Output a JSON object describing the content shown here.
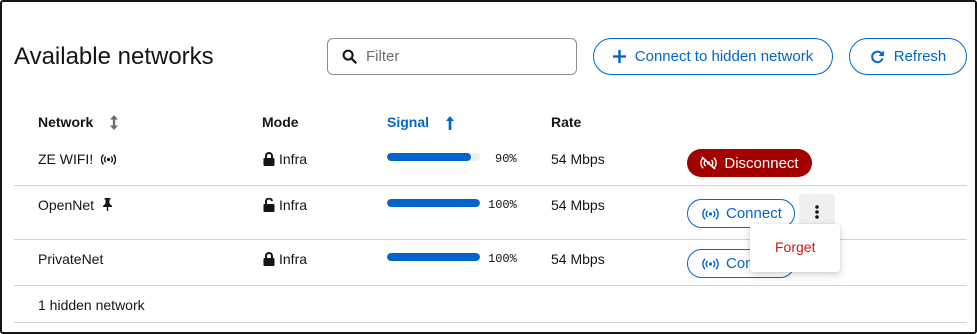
{
  "title": "Available networks",
  "filter": {
    "placeholder": "Filter",
    "value": ""
  },
  "buttons": {
    "connect_hidden": "Connect to hidden network",
    "refresh": "Refresh"
  },
  "table": {
    "columns": {
      "network": "Network",
      "mode": "Mode",
      "signal": "Signal",
      "rate": "Rate"
    },
    "sorted_column": "Signal",
    "rows": [
      {
        "name": "ZE WIFI!",
        "name_icon": "wifi-broadcast-icon",
        "mode": "Infra",
        "lock": "locked",
        "signal": 90,
        "signal_label": "90%",
        "rate": "54 Mbps",
        "action": "Disconnect"
      },
      {
        "name": "OpenNet",
        "name_icon": "pin-icon",
        "mode": "Infra",
        "lock": "unlocked",
        "signal": 100,
        "signal_label": "100%",
        "rate": "54 Mbps",
        "action": "Connect"
      },
      {
        "name": "PrivateNet",
        "name_icon": "",
        "mode": "Infra",
        "lock": "locked",
        "signal": 100,
        "signal_label": "100%",
        "rate": "54 Mbps",
        "action": "Connect"
      }
    ]
  },
  "row_menu": {
    "items": [
      "Forget"
    ]
  },
  "footer": "1 hidden network",
  "colors": {
    "accent": "#0066cc",
    "danger": "#a30000",
    "danger_text": "#c9190b",
    "border": "#d2d2d2"
  }
}
